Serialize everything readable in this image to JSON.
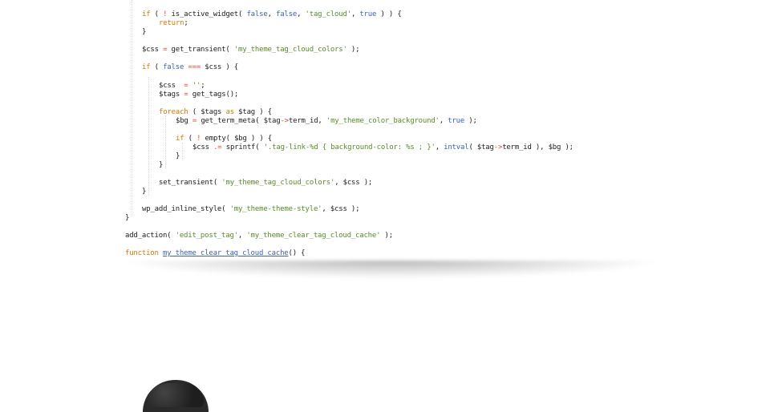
{
  "code": {
    "lines": [
      [
        {
          "t": "if",
          "c": "kw"
        },
        {
          "t": " ( ",
          "c": "punc"
        },
        {
          "t": "!",
          "c": "op"
        },
        {
          "t": " is_active_widget( ",
          "c": "fn"
        },
        {
          "t": "false",
          "c": "bool"
        },
        {
          "t": ", ",
          "c": "punc"
        },
        {
          "t": "false",
          "c": "bool"
        },
        {
          "t": ", ",
          "c": "punc"
        },
        {
          "t": "'tag_cloud'",
          "c": "str"
        },
        {
          "t": ", ",
          "c": "punc"
        },
        {
          "t": "true",
          "c": "bool"
        },
        {
          "t": " ) ) {",
          "c": "punc"
        }
      ],
      [
        {
          "t": "return",
          "c": "kw"
        },
        {
          "t": ";",
          "c": "punc"
        }
      ],
      [
        {
          "t": "}",
          "c": "punc"
        }
      ],
      [],
      [
        {
          "t": "$css",
          "c": "var"
        },
        {
          "t": " = ",
          "c": "op"
        },
        {
          "t": "get_transient( ",
          "c": "fn"
        },
        {
          "t": "'my_theme_tag_cloud_colors'",
          "c": "str"
        },
        {
          "t": " );",
          "c": "punc"
        }
      ],
      [],
      [
        {
          "t": "if",
          "c": "kw"
        },
        {
          "t": " ( ",
          "c": "punc"
        },
        {
          "t": "false",
          "c": "bool"
        },
        {
          "t": " === ",
          "c": "op"
        },
        {
          "t": "$css",
          "c": "var"
        },
        {
          "t": " ) {",
          "c": "punc"
        }
      ],
      [],
      [
        {
          "t": "$css",
          "c": "var"
        },
        {
          "t": "  = ",
          "c": "op"
        },
        {
          "t": "''",
          "c": "str"
        },
        {
          "t": ";",
          "c": "punc"
        }
      ],
      [
        {
          "t": "$tags",
          "c": "var"
        },
        {
          "t": " = ",
          "c": "op"
        },
        {
          "t": "get_tags();",
          "c": "fn"
        }
      ],
      [],
      [
        {
          "t": "foreach",
          "c": "kw"
        },
        {
          "t": " ( ",
          "c": "punc"
        },
        {
          "t": "$tags",
          "c": "var"
        },
        {
          "t": " as ",
          "c": "kw"
        },
        {
          "t": "$tag",
          "c": "var"
        },
        {
          "t": " ) {",
          "c": "punc"
        }
      ],
      [
        {
          "t": "$bg",
          "c": "var"
        },
        {
          "t": " = ",
          "c": "op"
        },
        {
          "t": "get_term_meta( ",
          "c": "fn"
        },
        {
          "t": "$tag",
          "c": "var"
        },
        {
          "t": "->",
          "c": "op"
        },
        {
          "t": "term_id, ",
          "c": "var"
        },
        {
          "t": "'my_theme_color_background'",
          "c": "str"
        },
        {
          "t": ", ",
          "c": "punc"
        },
        {
          "t": "true",
          "c": "bool"
        },
        {
          "t": " );",
          "c": "punc"
        }
      ],
      [],
      [
        {
          "t": "if",
          "c": "kw"
        },
        {
          "t": " ( ",
          "c": "punc"
        },
        {
          "t": "!",
          "c": "op"
        },
        {
          "t": " empty( ",
          "c": "fn"
        },
        {
          "t": "$bg",
          "c": "var"
        },
        {
          "t": " ) ) {",
          "c": "punc"
        }
      ],
      [
        {
          "t": "$css",
          "c": "var"
        },
        {
          "t": " .= ",
          "c": "op"
        },
        {
          "t": "sprintf( ",
          "c": "fn"
        },
        {
          "t": "'.tag-link-%d { background-color: %s ; }'",
          "c": "str"
        },
        {
          "t": ", ",
          "c": "punc"
        },
        {
          "t": "intval",
          "c": "bool"
        },
        {
          "t": "( ",
          "c": "punc"
        },
        {
          "t": "$tag",
          "c": "var"
        },
        {
          "t": "->",
          "c": "op"
        },
        {
          "t": "term_id ), $bg );",
          "c": "var"
        }
      ],
      [
        {
          "t": "}",
          "c": "punc"
        }
      ],
      [
        {
          "t": "}",
          "c": "punc"
        }
      ],
      [],
      [
        {
          "t": "set_transient( ",
          "c": "fn"
        },
        {
          "t": "'my_theme_tag_cloud_colors'",
          "c": "str"
        },
        {
          "t": ", ",
          "c": "punc"
        },
        {
          "t": "$css",
          "c": "var"
        },
        {
          "t": " );",
          "c": "punc"
        }
      ],
      [
        {
          "t": "}",
          "c": "punc"
        }
      ],
      [],
      [
        {
          "t": "wp_add_inline_style( ",
          "c": "fn"
        },
        {
          "t": "'my_theme-theme-style'",
          "c": "str"
        },
        {
          "t": ", ",
          "c": "punc"
        },
        {
          "t": "$css",
          "c": "var"
        },
        {
          "t": " );",
          "c": "punc"
        }
      ],
      [
        {
          "t": "}",
          "c": "punc"
        }
      ],
      [],
      [
        {
          "t": "add_action( ",
          "c": "fn"
        },
        {
          "t": "'edit_post_tag'",
          "c": "str"
        },
        {
          "t": ", ",
          "c": "punc"
        },
        {
          "t": "'my_theme_clear_tag_cloud_cache'",
          "c": "str"
        },
        {
          "t": " );",
          "c": "punc"
        }
      ],
      [],
      [
        {
          "t": "function",
          "c": "kw"
        },
        {
          "t": " ",
          "c": "punc"
        },
        {
          "t": "my_theme_clear_tag_cloud_cache",
          "c": "fname"
        },
        {
          "t": "() {",
          "c": "punc"
        }
      ]
    ]
  },
  "colors": {
    "keyword": "#d97706",
    "boolean": "#3b5fc4",
    "string": "#5a8a2e",
    "operator": "#d14b3a",
    "text": "#222222"
  }
}
